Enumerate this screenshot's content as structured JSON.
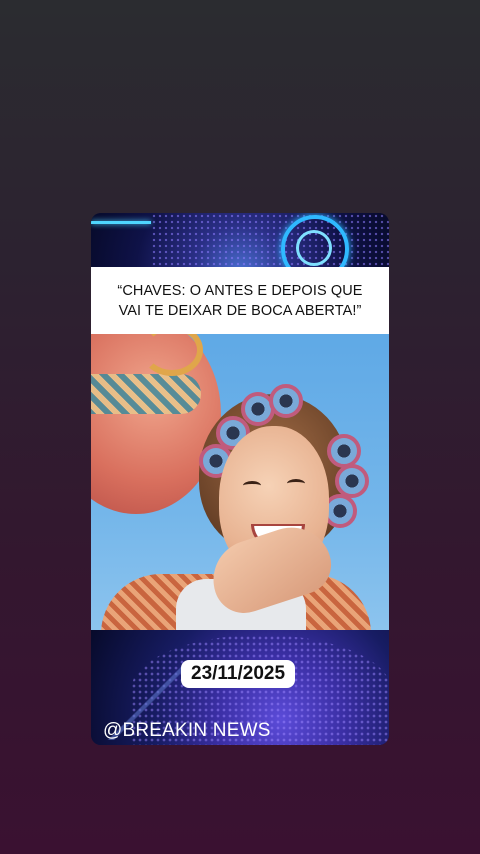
{
  "post": {
    "headline": "“CHAVES: O ANTES E DEPOIS QUE VAI TE DEIXAR DE BOCA ABERTA!”",
    "date": "23/11/2025",
    "handle": "@BREAKIN NEWS"
  }
}
